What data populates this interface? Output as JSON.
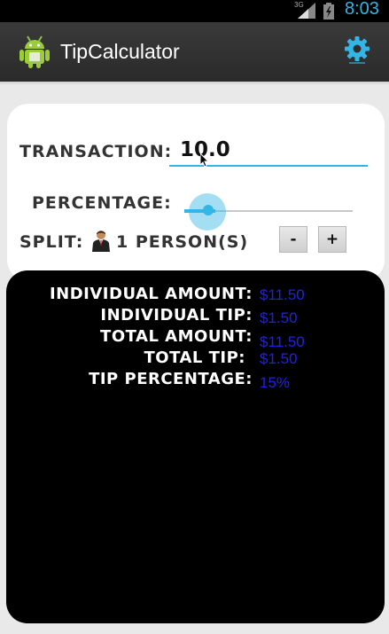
{
  "status_bar": {
    "network": "3G",
    "time": "8:03"
  },
  "app": {
    "title": "TipCalculator"
  },
  "form": {
    "transaction_label": "TRANSACTION:",
    "transaction_value": "10.0",
    "percentage_label": "PERCENTAGE:",
    "percentage_value": 0.15,
    "split_label": "SPLIT:",
    "split_value": "1 PERSON(S)",
    "minus_label": "-",
    "plus_label": "+"
  },
  "results": {
    "individual_amount_label": "INDIVIDUAL AMOUNT:",
    "individual_amount_value": "$11.50",
    "individual_tip_label": "INDIVIDUAL TIP:",
    "individual_tip_value": "$1.50",
    "total_amount_label": "TOTAL AMOUNT:",
    "total_amount_value": "$11.50",
    "total_tip_label": "TOTAL TIP:",
    "total_tip_value": "$1.50",
    "tip_percentage_label": "TIP PERCENTAGE:",
    "tip_percentage_value": "15%"
  },
  "colors": {
    "accent": "#33b5e5",
    "value_text": "#2222dd",
    "results_bg": "#000000"
  },
  "icons": [
    "android-app-icon",
    "settings-gear-icon",
    "person-icon",
    "signal-icon",
    "battery-icon"
  ]
}
